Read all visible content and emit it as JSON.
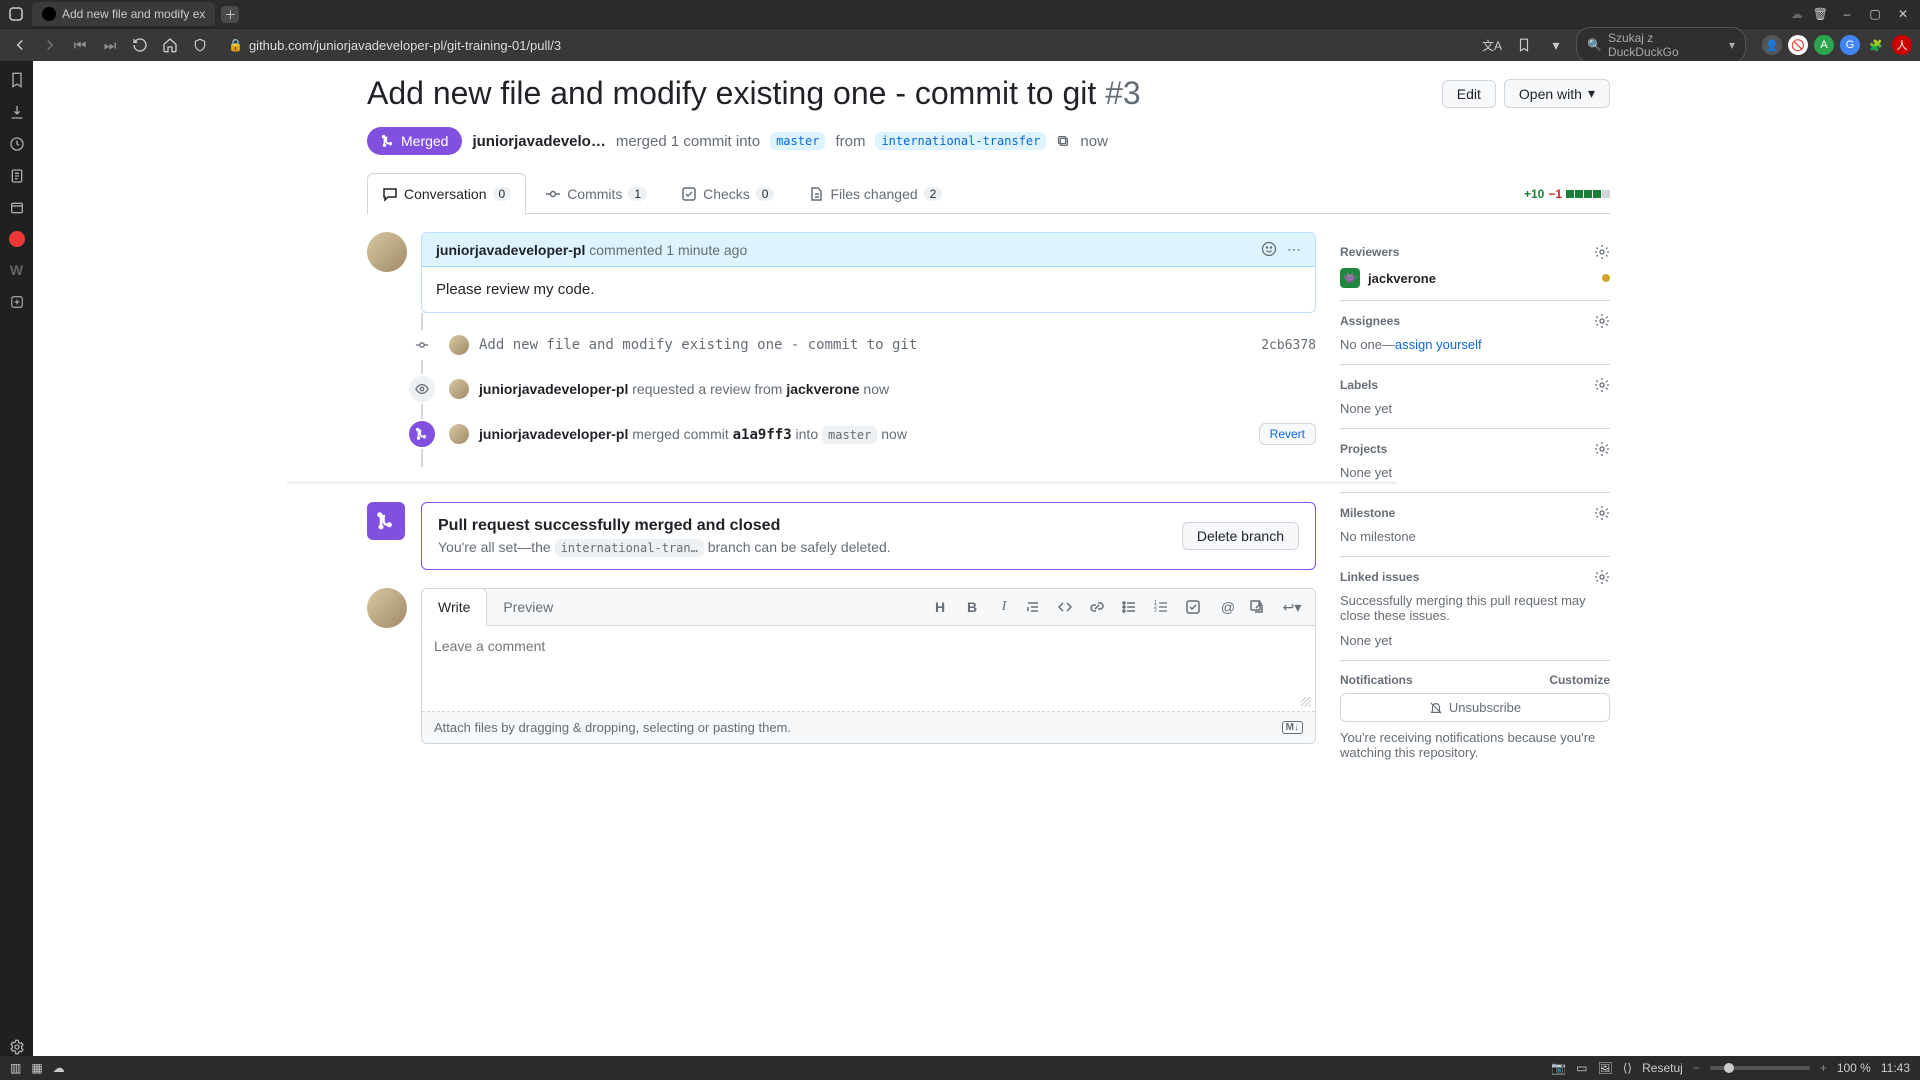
{
  "browser": {
    "tab_title": "Add new file and modify ex",
    "url_display": "github.com/juniorjavadeveloper-pl/git-training-01/pull/3",
    "search_placeholder": "Szukaj z DuckDuckGo"
  },
  "pr": {
    "title": "Add new file and modify existing one - commit to git",
    "number": "#3",
    "edit_label": "Edit",
    "open_with_label": "Open with",
    "state_label": "Merged",
    "merged_by_truncated": "juniorjavadevelo…",
    "merge_sentence_merged": "merged 1 commit into",
    "base_branch": "master",
    "merge_sentence_from": "from",
    "head_branch": "international-transfer",
    "merge_time": "now"
  },
  "tabs": {
    "conversation": {
      "label": "Conversation",
      "count": "0"
    },
    "commits": {
      "label": "Commits",
      "count": "1"
    },
    "checks": {
      "label": "Checks",
      "count": "0"
    },
    "files": {
      "label": "Files changed",
      "count": "2"
    }
  },
  "diffstat": {
    "plus": "+10",
    "minus": "−1"
  },
  "comment": {
    "author": "juniorjavadeveloper-pl",
    "meta": "commented 1 minute ago",
    "body": "Please review my code."
  },
  "timeline": {
    "commit": {
      "message": "Add new file and modify existing one - commit to git",
      "sha": "2cb6378"
    },
    "review_request": {
      "actor": "juniorjavadeveloper-pl",
      "verb": "requested a review from",
      "target": "jackverone",
      "when": "now"
    },
    "merge": {
      "actor": "juniorjavadeveloper-pl",
      "verb": "merged commit",
      "sha": "a1a9ff3",
      "into": "into",
      "branch": "master",
      "when": "now",
      "revert_label": "Revert"
    }
  },
  "merged_box": {
    "title": "Pull request successfully merged and closed",
    "sub_pre": "You're all set—the",
    "branch_trunc": "international-tran…",
    "sub_post": "branch can be safely deleted.",
    "delete_label": "Delete branch"
  },
  "compose": {
    "write_tab": "Write",
    "preview_tab": "Preview",
    "placeholder": "Leave a comment",
    "attach_hint": "Attach files by dragging & dropping, selecting or pasting them."
  },
  "sidebar": {
    "reviewers": {
      "title": "Reviewers",
      "name": "jackverone"
    },
    "assignees": {
      "title": "Assignees",
      "body_pre": "No one—",
      "assign_self": "assign yourself"
    },
    "labels": {
      "title": "Labels",
      "body": "None yet"
    },
    "projects": {
      "title": "Projects",
      "body": "None yet"
    },
    "milestone": {
      "title": "Milestone",
      "body": "No milestone"
    },
    "linked": {
      "title": "Linked issues",
      "desc": "Successfully merging this pull request may close these issues.",
      "body": "None yet"
    },
    "notifications": {
      "title": "Notifications",
      "customize": "Customize",
      "unsub": "Unsubscribe",
      "desc": "You're receiving notifications because you're watching this repository."
    }
  },
  "status": {
    "reset": "Resetuj",
    "zoom": "100 %",
    "clock": "11:43"
  }
}
